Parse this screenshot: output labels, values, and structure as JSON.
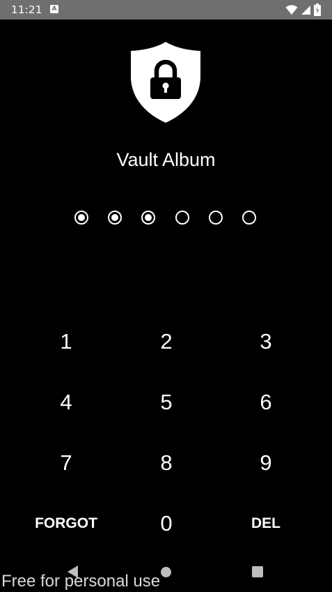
{
  "status_bar": {
    "time": "11:21",
    "notification_icon": "a-icon",
    "icons": [
      "wifi-icon",
      "signal-icon",
      "battery-icon"
    ]
  },
  "app": {
    "icon": "shield-lock-icon",
    "title": "Vault Album"
  },
  "pin": {
    "length": 6,
    "entered": 3
  },
  "keypad": {
    "rows": [
      [
        "1",
        "2",
        "3"
      ],
      [
        "4",
        "5",
        "6"
      ],
      [
        "7",
        "8",
        "9"
      ]
    ],
    "forgot_label": "FORGOT",
    "zero_label": "0",
    "del_label": "DEL"
  },
  "nav_bar": {
    "icons": [
      "back-icon",
      "home-icon",
      "recents-icon"
    ]
  },
  "watermark": "Free for personal use",
  "colors": {
    "background": "#000000",
    "status_bar": "#6f6f6f",
    "foreground": "#ffffff",
    "nav_icons": "#bdbdbd"
  }
}
